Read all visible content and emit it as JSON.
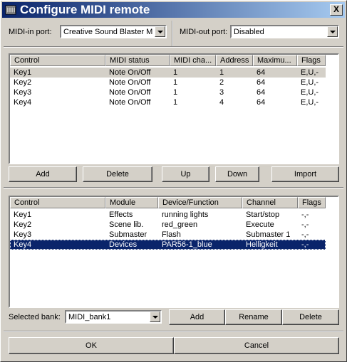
{
  "window": {
    "title": "Configure MIDI remote",
    "close_label": "X"
  },
  "ports": {
    "midi_in_label": "MIDI-in port:",
    "midi_in_value": "Creative Sound Blaster MP",
    "midi_out_label": "MIDI-out port:",
    "midi_out_value": "Disabled"
  },
  "mapping_table": {
    "columns": [
      "Control",
      "MIDI status",
      "MIDI cha...",
      "Address",
      "Maximu...",
      "Flags"
    ],
    "rows": [
      [
        "Key1",
        "Note On/Off",
        "1",
        "1",
        "64",
        "E,U,-"
      ],
      [
        "Key2",
        "Note On/Off",
        "1",
        "2",
        "64",
        "E,U,-"
      ],
      [
        "Key3",
        "Note On/Off",
        "1",
        "3",
        "64",
        "E,U,-"
      ],
      [
        "Key4",
        "Note On/Off",
        "1",
        "4",
        "64",
        "E,U,-"
      ]
    ]
  },
  "mapping_buttons": {
    "add": "Add",
    "delete": "Delete",
    "up": "Up",
    "down": "Down",
    "import": "Import"
  },
  "function_table": {
    "columns": [
      "Control",
      "Module",
      "Device/Function",
      "Channel",
      "Flags"
    ],
    "rows": [
      [
        "Key1",
        "Effects",
        "running lights",
        "Start/stop",
        "-,-"
      ],
      [
        "Key2",
        "Scene lib.",
        "red_green",
        "Execute",
        "-,-"
      ],
      [
        "Key3",
        "Submaster",
        "Flash",
        "Submaster 1",
        "-,-"
      ],
      [
        "Key4",
        "Devices",
        "PAR56-1_blue",
        "Helligkeit",
        "-,-"
      ]
    ]
  },
  "bank": {
    "label": "Selected bank:",
    "value": "MIDI_bank1",
    "add": "Add",
    "rename": "Rename",
    "delete": "Delete"
  },
  "footer": {
    "ok": "OK",
    "cancel": "Cancel"
  },
  "colors": {
    "titlebar_start": "#0a246a",
    "titlebar_end": "#a6caf0",
    "selection": "#0a246a",
    "face": "#d4d0c8"
  }
}
